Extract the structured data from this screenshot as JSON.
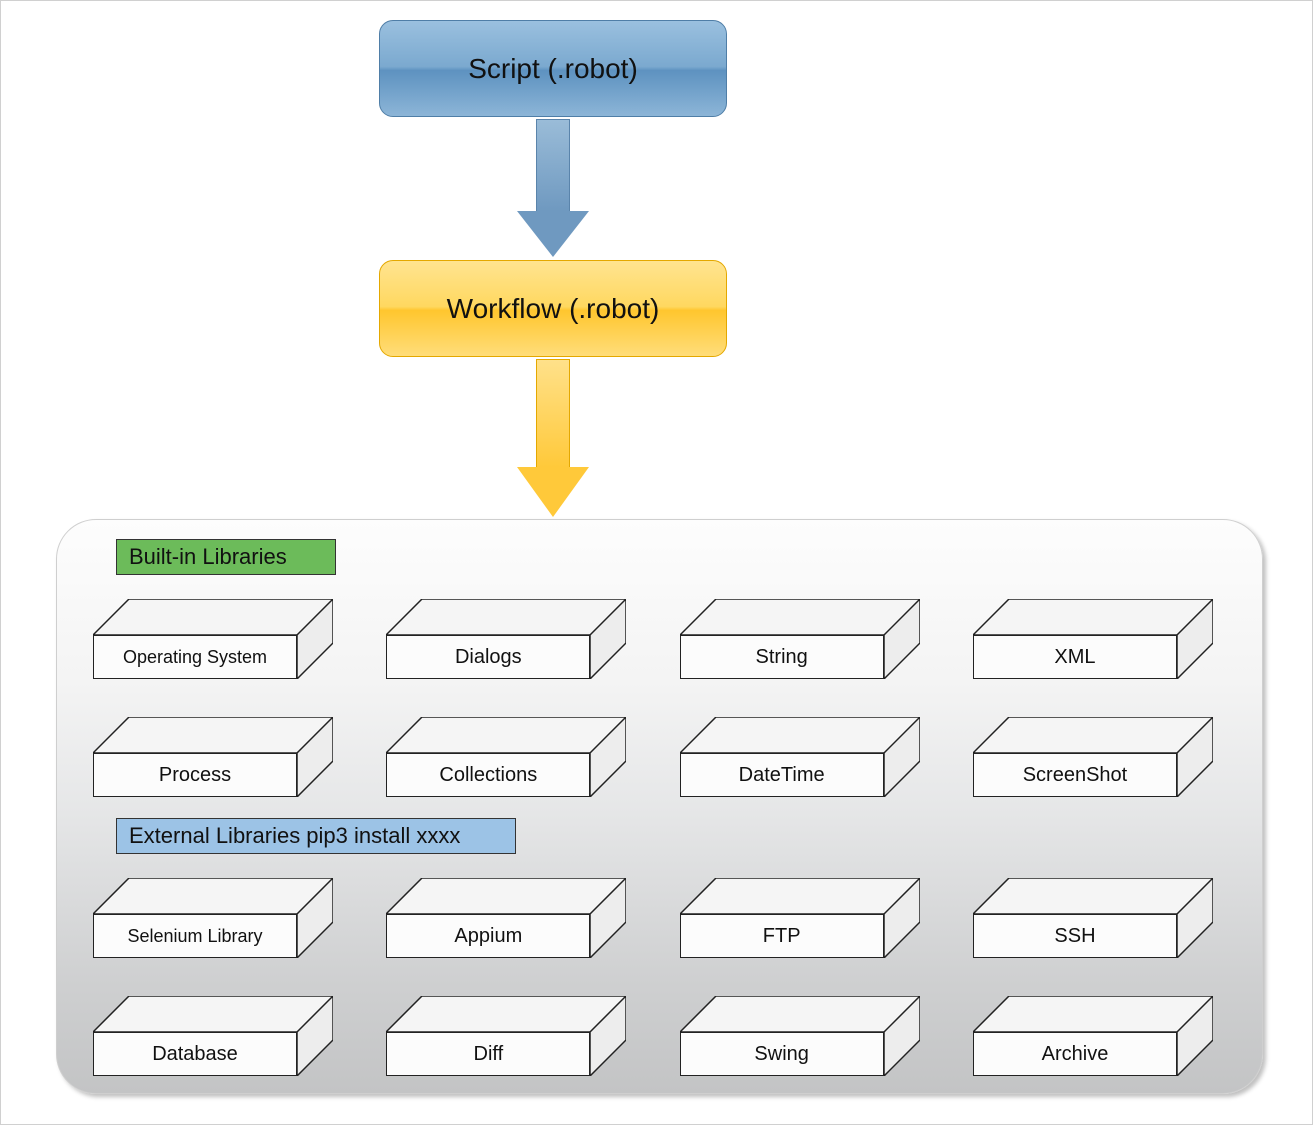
{
  "nodes": {
    "script": "Script (.robot)",
    "workflow": "Workflow (.robot)"
  },
  "sections": {
    "builtin": {
      "label": "Built-in Libraries",
      "row1": [
        "Operating System",
        "Dialogs",
        "String",
        "XML"
      ],
      "row2": [
        "Process",
        "Collections",
        "DateTime",
        "ScreenShot"
      ]
    },
    "external": {
      "label": "External Libraries pip3 install xxxx",
      "row1": [
        "Selenium Library",
        "Appium",
        "FTP",
        "SSH"
      ],
      "row2": [
        "Database",
        "Diff",
        "Swing",
        "Archive"
      ]
    }
  }
}
